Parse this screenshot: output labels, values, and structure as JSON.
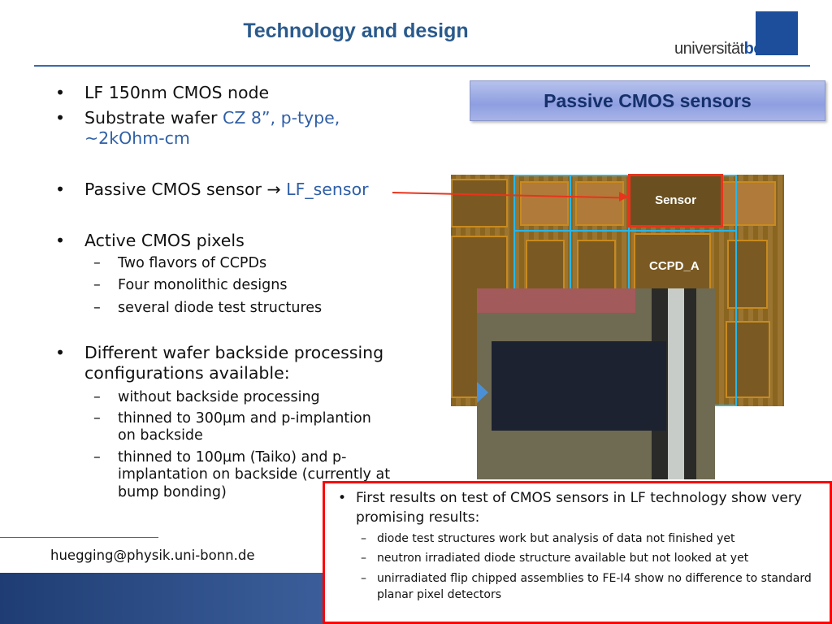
{
  "title": "Technology and design",
  "logo": {
    "text_plain": "universität",
    "text_bold": "bonn"
  },
  "bullets": {
    "b1": "LF 150nm CMOS node",
    "b2_plain": "Substrate wafer ",
    "b2_blue": "CZ 8”, p-type,",
    "b2_line2": "~2kOhm-cm",
    "b3_plain": "Passive CMOS sensor ",
    "b3_arrow": "→",
    "b3_blue": " LF_sensor",
    "b4": "Active CMOS pixels",
    "b4_subs": [
      "Two flavors of CCPDs",
      "Four monolithic designs",
      "several diode test structures"
    ],
    "b5_line1": "Different wafer backside processing",
    "b5_line2": "configurations available:",
    "b5_subs": [
      [
        "without backside processing"
      ],
      [
        "thinned to 300µm and p-implantion",
        "on backside"
      ],
      [
        "thinned to 100µm (Taiko) and p-",
        "implantation on backside (currently at",
        "bump bonding)"
      ]
    ]
  },
  "passive_header": "Passive CMOS sensors",
  "chip_labels": {
    "sensor": "Sensor",
    "ccpd": "CCPD_A"
  },
  "results": {
    "main_line1": "First results on test of CMOS sensors in LF technology show very",
    "main_line2": "promising results:",
    "subs": [
      [
        "diode test structures work but analysis of data not finished yet"
      ],
      [
        "neutron irradiated diode structure available but not looked at yet"
      ],
      [
        "unirradiated flip chipped assemblies to FE-I4 show no difference to standard",
        "planar pixel detectors"
      ]
    ]
  },
  "email": "huegging@physik.uni-bonn.de",
  "colors": {
    "title": "#2a5a8c",
    "accent_blue": "#2f5fa6",
    "highlight_red": "#e8341c",
    "results_border": "#ff0000"
  }
}
